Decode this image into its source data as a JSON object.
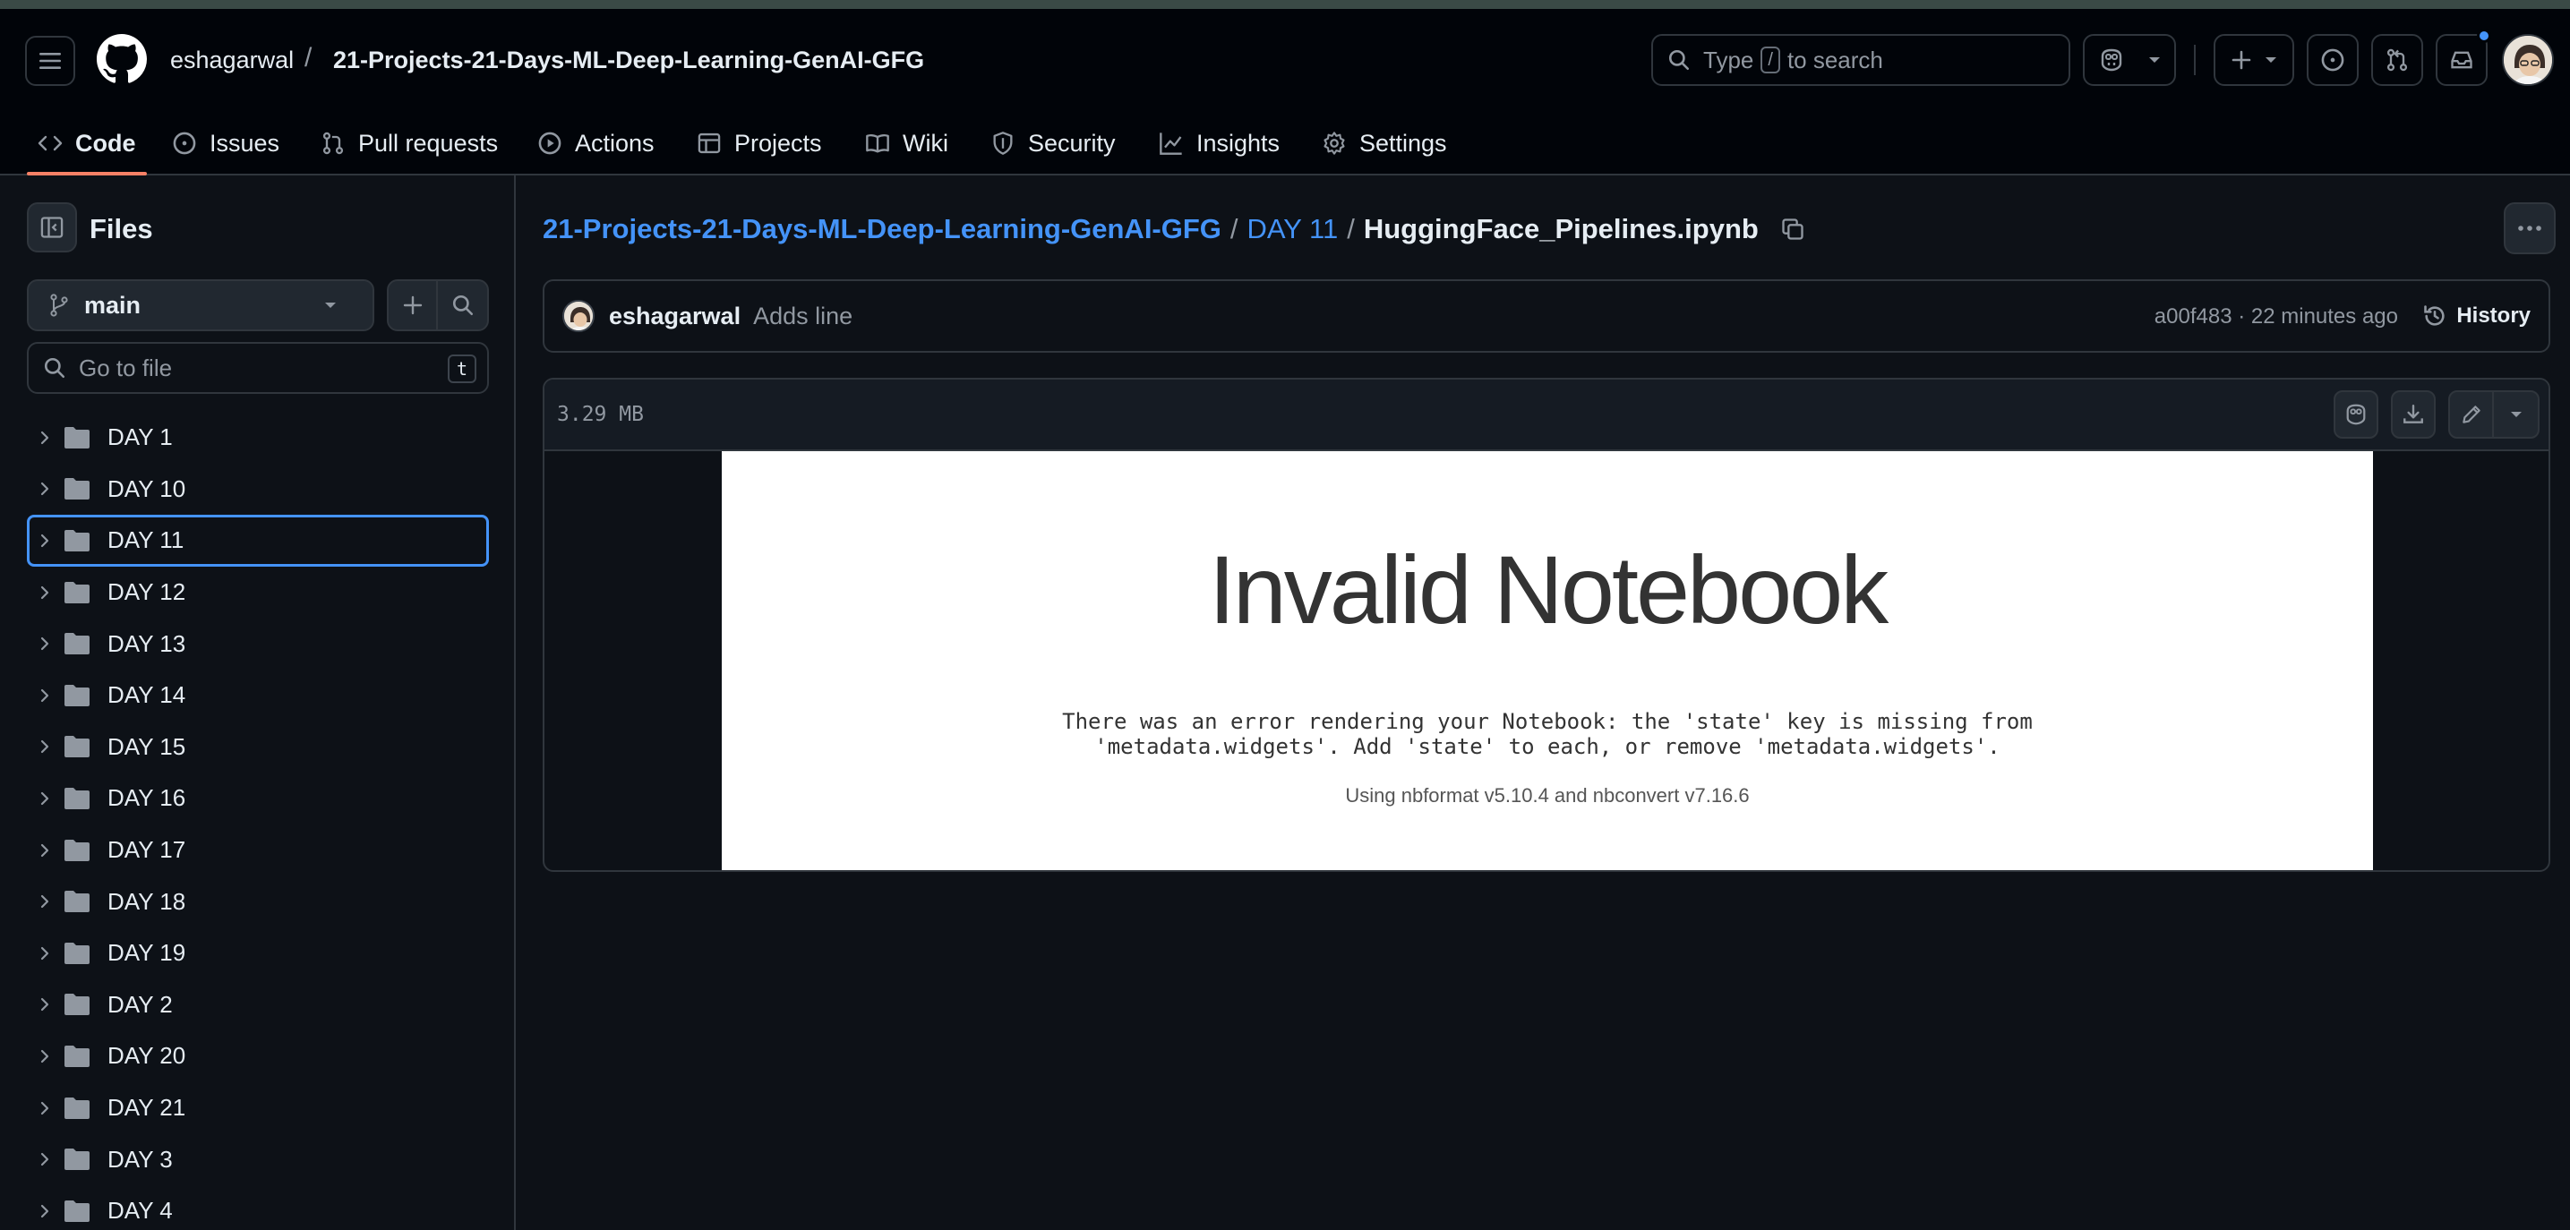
{
  "header": {
    "owner": "eshagarwal",
    "separator": "/",
    "repo": "21-Projects-21-Days-ML-Deep-Learning-GenAI-GFG",
    "search_prefix": "Type",
    "search_key": "/",
    "search_suffix": "to search"
  },
  "tabs": [
    {
      "label": "Code",
      "icon": "code-icon"
    },
    {
      "label": "Issues",
      "icon": "issue-icon"
    },
    {
      "label": "Pull requests",
      "icon": "pull-request-icon"
    },
    {
      "label": "Actions",
      "icon": "play-icon"
    },
    {
      "label": "Projects",
      "icon": "table-icon"
    },
    {
      "label": "Wiki",
      "icon": "book-icon"
    },
    {
      "label": "Security",
      "icon": "shield-icon"
    },
    {
      "label": "Insights",
      "icon": "graph-icon"
    },
    {
      "label": "Settings",
      "icon": "gear-icon"
    }
  ],
  "sidebar": {
    "title": "Files",
    "branch": "main",
    "go_to_file_placeholder": "Go to file",
    "go_to_file_key": "t",
    "items": [
      {
        "label": "DAY 1"
      },
      {
        "label": "DAY 10"
      },
      {
        "label": "DAY 11",
        "selected": true
      },
      {
        "label": "DAY 12"
      },
      {
        "label": "DAY 13"
      },
      {
        "label": "DAY 14"
      },
      {
        "label": "DAY 15"
      },
      {
        "label": "DAY 16"
      },
      {
        "label": "DAY 17"
      },
      {
        "label": "DAY 18"
      },
      {
        "label": "DAY 19"
      },
      {
        "label": "DAY 2"
      },
      {
        "label": "DAY 20"
      },
      {
        "label": "DAY 21"
      },
      {
        "label": "DAY 3"
      },
      {
        "label": "DAY 4"
      }
    ]
  },
  "main": {
    "path_repo": "21-Projects-21-Days-ML-Deep-Learning-GenAI-GFG",
    "path_sep": "/",
    "path_folder": "DAY 11",
    "path_file": "HuggingFace_Pipelines.ipynb",
    "commit": {
      "author": "eshagarwal",
      "message": "Adds line",
      "meta": "a00f483 · 22 minutes ago",
      "history_label": "History"
    },
    "file": {
      "size": "3.29 MB",
      "notebook_title": "Invalid Notebook",
      "error_text": "There was an error rendering your Notebook: the 'state' key is missing from\n'metadata.widgets'. Add 'state' to each, or remove 'metadata.widgets'.",
      "version_text": "Using nbformat v5.10.4 and nbconvert v7.16.6"
    }
  },
  "colors": {
    "background": "#0d1117",
    "header_bg": "#010409",
    "border": "#30363d",
    "link": "#4493f8",
    "tab_underline": "#f78166",
    "notification_dot": "#4493f8"
  }
}
